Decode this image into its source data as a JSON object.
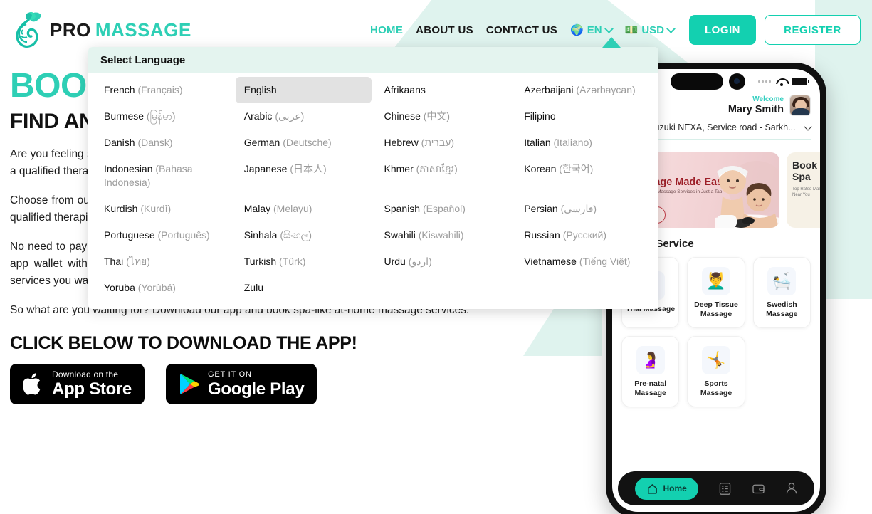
{
  "brand": {
    "name_pro": "PRO",
    "name_massage": "MASSAGE",
    "logo_icon": "leaf-face-logo"
  },
  "nav": {
    "links": [
      {
        "label": "HOME",
        "active": true
      },
      {
        "label": "ABOUT US",
        "active": false
      },
      {
        "label": "CONTACT US",
        "active": false
      }
    ],
    "language_selector": {
      "icon": "globe-icon",
      "value": "EN",
      "chevron": "chevron-down-icon"
    },
    "currency_selector": {
      "icon": "money-icon",
      "value": "USD",
      "chevron": "chevron-down-icon"
    },
    "login_label": "LOGIN",
    "register_label": "REGISTER"
  },
  "hero": {
    "title": "BOOK A MASSAGE",
    "subtitle": "FIND AND BOOK WHENEVER",
    "paragraphs": [
      "Are you feeling stressed or have body pain? Do you want to pamper yourself with a relaxing massage from a qualified therapist at home?",
      "Choose from our wide range of massages like Thai, Swedish, sports massage and more. Our trained and qualified therapist will come to your home or hotel at the time you want.",
      "No need to pay in cash because we offer an online payment option. Pay with your credit/debit card or in-app wallet without stressing about carrying cash. Look for the best professionals nearby, choose the services you want, schedule their visit, or simply select Book Now for a quick massage.",
      "So what are you waiting for? Download our app and book spa-like at-home massage services."
    ],
    "cta_title": "CLICK BELOW TO DOWNLOAD THE APP!",
    "app_store": {
      "small": "Download on the",
      "big": "App Store",
      "icon": "apple-icon"
    },
    "google_play": {
      "small": "GET IT ON",
      "big": "Google Play",
      "icon": "google-play-icon"
    }
  },
  "language_dropdown": {
    "title": "Select Language",
    "items": [
      {
        "name": "French",
        "native": "(Français)",
        "selected": false
      },
      {
        "name": "English",
        "native": "",
        "selected": true
      },
      {
        "name": "Afrikaans",
        "native": "",
        "selected": false
      },
      {
        "name": "Azerbaijani",
        "native": "(Azərbaycan)",
        "selected": false
      },
      {
        "name": "Burmese",
        "native": "(မြန်မာ)",
        "selected": false
      },
      {
        "name": "Arabic",
        "native": "(عربى)",
        "selected": false
      },
      {
        "name": "Chinese",
        "native": "(中文)",
        "selected": false
      },
      {
        "name": "Filipino",
        "native": "",
        "selected": false
      },
      {
        "name": "Danish",
        "native": "(Dansk)",
        "selected": false
      },
      {
        "name": "German",
        "native": "(Deutsche)",
        "selected": false
      },
      {
        "name": "Hebrew",
        "native": "(עברית)",
        "selected": false
      },
      {
        "name": "Italian",
        "native": "(Italiano)",
        "selected": false
      },
      {
        "name": "Indonesian",
        "native": "(Bahasa Indonesia)",
        "selected": false
      },
      {
        "name": "Japanese",
        "native": "(日本人)",
        "selected": false
      },
      {
        "name": "Khmer",
        "native": "(ភាសាខ្មែរ)",
        "selected": false
      },
      {
        "name": "Korean",
        "native": "(한국어)",
        "selected": false
      },
      {
        "name": "Kurdish",
        "native": "(Kurdî)",
        "selected": false
      },
      {
        "name": "Malay",
        "native": "(Melayu)",
        "selected": false
      },
      {
        "name": "Spanish",
        "native": "(Español)",
        "selected": false
      },
      {
        "name": "Persian",
        "native": "(فارسی)",
        "selected": false
      },
      {
        "name": "Portuguese",
        "native": "(Português)",
        "selected": false
      },
      {
        "name": "Sinhala",
        "native": "(සිංහල)",
        "selected": false
      },
      {
        "name": "Swahili",
        "native": "(Kiswahili)",
        "selected": false
      },
      {
        "name": "Russian",
        "native": "(Русский)",
        "selected": false
      },
      {
        "name": "Thai",
        "native": "(ไทย)",
        "selected": false
      },
      {
        "name": "Turkish",
        "native": "(Türk)",
        "selected": false
      },
      {
        "name": "Urdu",
        "native": "(اردو)",
        "selected": false
      },
      {
        "name": "Vietnamese",
        "native": "(Tiếng Việt)",
        "selected": false
      },
      {
        "name": "Yoruba",
        "native": "(Yorùbá)",
        "selected": false
      },
      {
        "name": "Zulu",
        "native": "",
        "selected": false
      }
    ]
  },
  "phone": {
    "welcome_label": "Welcome",
    "user_name": "Mary Smith",
    "address": "Maruti Suzuki NEXA, Service road - Sarkh...",
    "promo": {
      "title": "Massage Made Easy",
      "subtitle": "Book Verified Massage Services in Just a Tap"
    },
    "promo2": {
      "title": "Book Spa",
      "subtitle": "Top Rated Massage Near You"
    },
    "section_title": "Select Service",
    "services": [
      {
        "label": "Thai Massage",
        "icon": "thai-massage-icon",
        "glyph": "💆"
      },
      {
        "label": "Deep Tissue Massage",
        "icon": "deep-tissue-icon",
        "glyph": "💆‍♂️"
      },
      {
        "label": "Swedish Massage",
        "icon": "swedish-icon",
        "glyph": "🛀"
      },
      {
        "label": "Pre-natal Massage",
        "icon": "prenatal-icon",
        "glyph": "🤰"
      },
      {
        "label": "Sports Massage",
        "icon": "sports-icon",
        "glyph": "🤸"
      }
    ],
    "tabs": [
      {
        "label": "Home",
        "icon": "home-icon",
        "active": true
      },
      {
        "label": "",
        "icon": "list-icon",
        "active": false
      },
      {
        "label": "",
        "icon": "wallet-icon",
        "active": false
      },
      {
        "label": "",
        "icon": "profile-icon",
        "active": false
      }
    ]
  },
  "colors": {
    "accent": "#13d0b0",
    "accent_light": "#2ecfb5",
    "mint_bg": "#dff3ee",
    "dark": "#111111"
  }
}
